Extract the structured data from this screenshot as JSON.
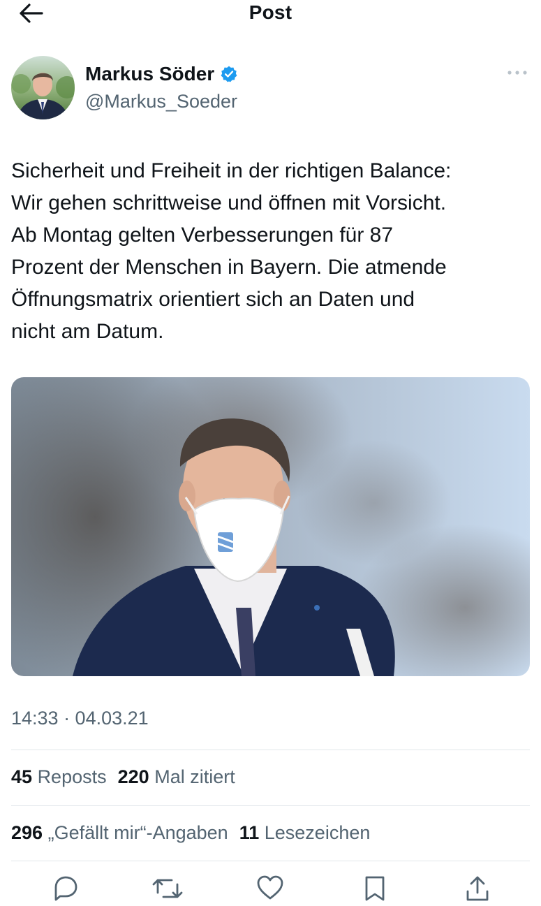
{
  "header": {
    "title": "Post",
    "back_icon": "arrow-left-icon"
  },
  "author": {
    "name": "Markus Söder",
    "handle": "@Markus_Soeder",
    "verified_icon": "verified-badge-icon",
    "more_icon": "more-horizontal-icon"
  },
  "tweet": {
    "text": "Sicherheit und Freiheit in der richtigen Balance:\nWir gehen schrittweise und öffnen mit Vorsicht.\nAb Montag gelten Verbesserungen für 87\nProzent der Menschen in Bayern. Die atmende\nÖffnungsmatrix orientiert sich an Daten und\nnicht am Datum.",
    "timestamp": "14:33 · 04.03.21"
  },
  "stats": {
    "reposts_count": "45",
    "reposts_label": "Reposts",
    "quotes_count": "220",
    "quotes_label": "Mal zitiert",
    "likes_count": "296",
    "likes_label": "„Gefällt mir“-Angaben",
    "bookmarks_count": "11",
    "bookmarks_label": "Lesezeichen"
  },
  "actions": [
    "reply-icon",
    "repost-icon",
    "like-icon",
    "bookmark-icon",
    "share-icon"
  ],
  "colors": {
    "text_primary": "#0f1419",
    "text_secondary": "#536471",
    "verified_blue": "#1d9bf0",
    "divider": "#e1e6ea"
  }
}
